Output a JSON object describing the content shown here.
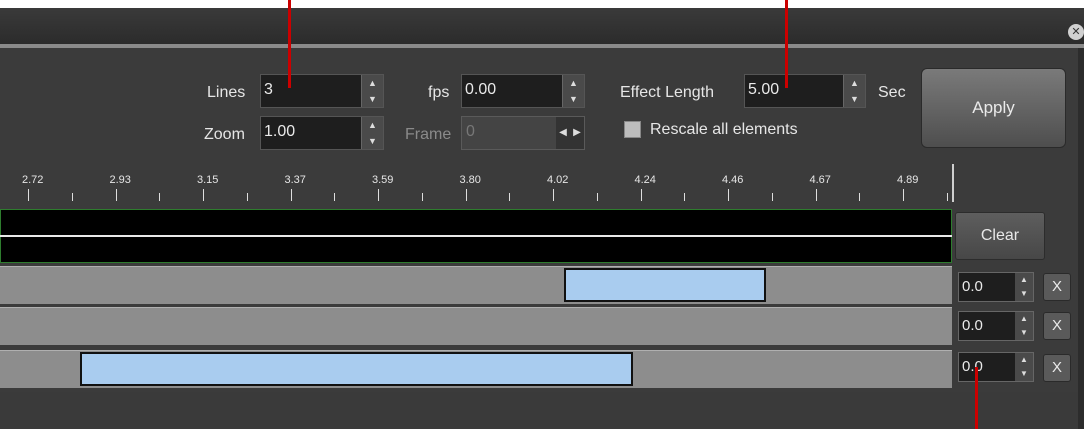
{
  "window": {
    "close_glyph": "✕"
  },
  "controls": {
    "lines_label": "Lines",
    "lines_value": "3",
    "zoom_label": "Zoom",
    "zoom_value": "1.00",
    "fps_label": "fps",
    "fps_value": "0.00",
    "frame_label": "Frame",
    "frame_value": "0",
    "effect_length_label": "Effect Length",
    "effect_length_value": "5.00",
    "sec_label": "Sec",
    "rescale_label": "Rescale all elements",
    "apply_label": "Apply"
  },
  "ruler": {
    "ticks": [
      "2.72",
      "2.93",
      "3.15",
      "3.37",
      "3.59",
      "3.80",
      "4.02",
      "4.24",
      "4.46",
      "4.67",
      "4.89"
    ]
  },
  "track": {
    "clear_label": "Clear"
  },
  "rows": [
    {
      "offset": "0.0",
      "remove_label": "X",
      "bar_start": 4.05,
      "bar_end": 4.55
    },
    {
      "offset": "0.0",
      "remove_label": "X"
    },
    {
      "offset": "0.0",
      "remove_label": "X",
      "bar_start": 2.85,
      "bar_end": 4.22
    }
  ],
  "colors": {
    "bar_fill": "#a9ccef",
    "annotation_marker": "#cc0000",
    "track_border": "#2e7d2e"
  }
}
